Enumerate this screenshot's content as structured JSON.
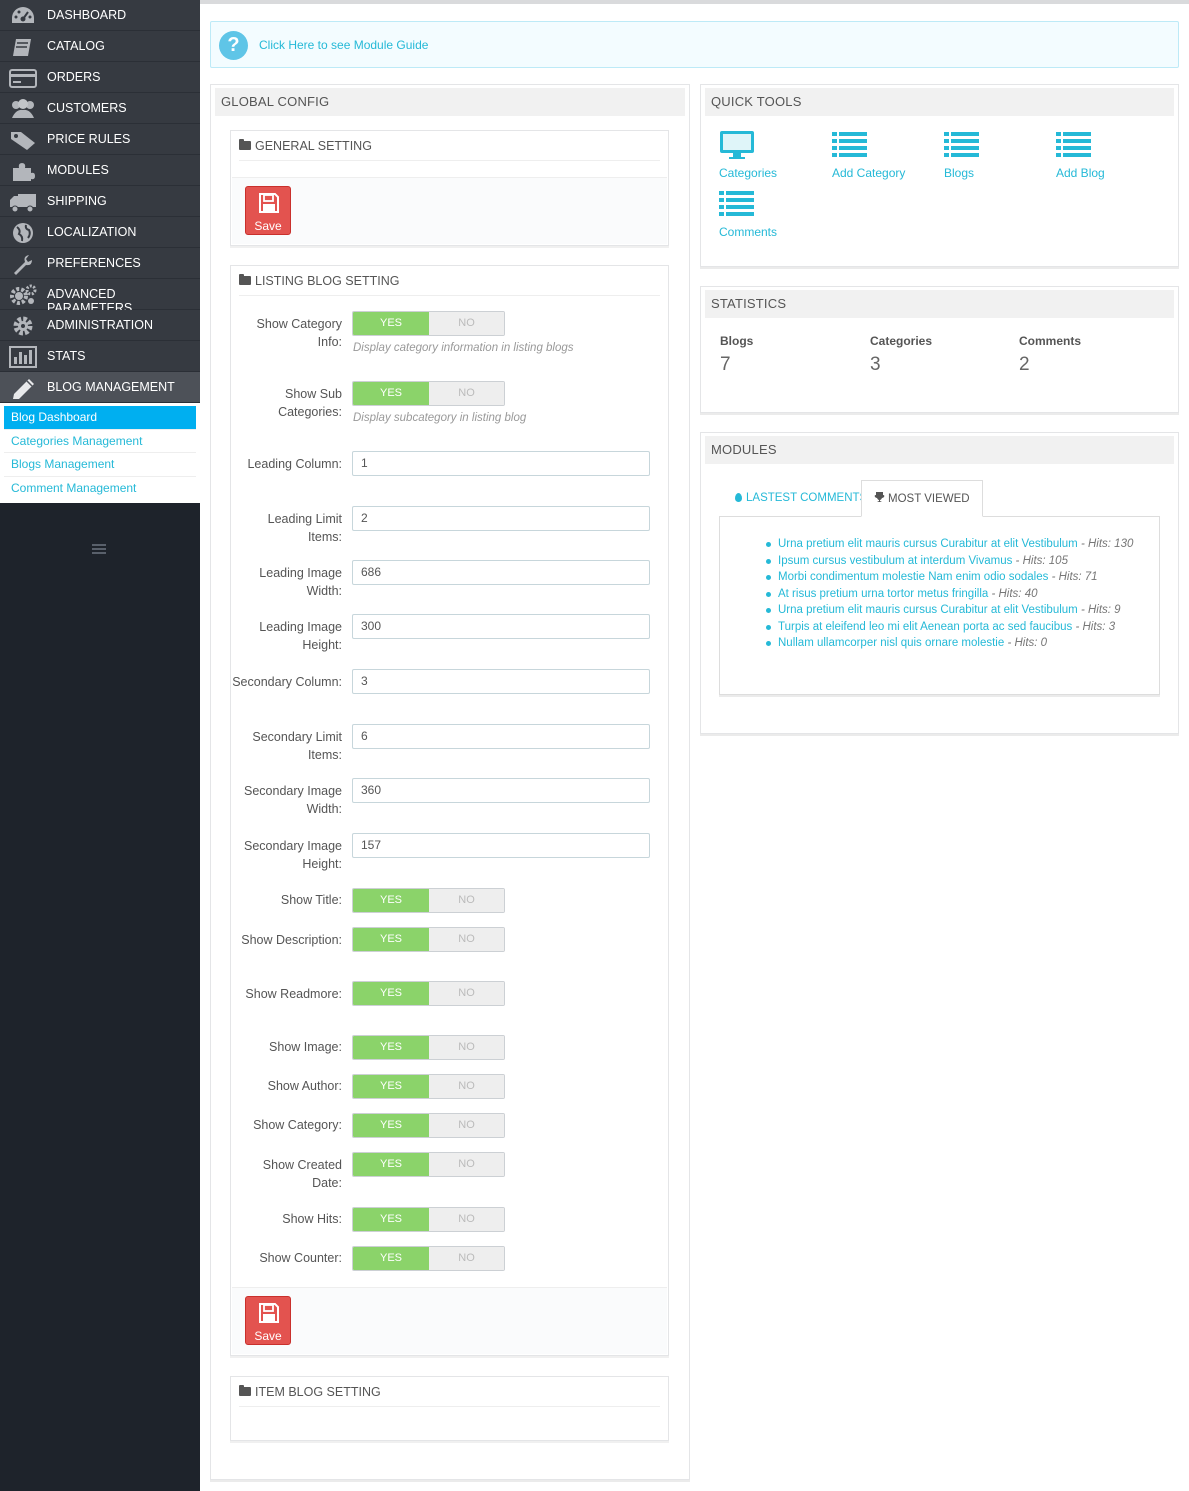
{
  "sidebar": {
    "menu": [
      {
        "label": "DASHBOARD",
        "icon": "dashboard-icon"
      },
      {
        "label": "CATALOG",
        "icon": "book-icon"
      },
      {
        "label": "ORDERS",
        "icon": "credit-card-icon"
      },
      {
        "label": "CUSTOMERS",
        "icon": "users-icon"
      },
      {
        "label": "PRICE RULES",
        "icon": "tags-icon"
      },
      {
        "label": "MODULES",
        "icon": "puzzle-icon"
      },
      {
        "label": "SHIPPING",
        "icon": "truck-icon"
      },
      {
        "label": "LOCALIZATION",
        "icon": "globe-icon"
      },
      {
        "label": "PREFERENCES",
        "icon": "wrench-icon"
      },
      {
        "label": "ADVANCED PARAMETERS",
        "icon": "cogs-icon"
      },
      {
        "label": "ADMINISTRATION",
        "icon": "cog-icon"
      },
      {
        "label": "STATS",
        "icon": "bar-chart-icon"
      },
      {
        "label": "BLOG MANAGEMENT",
        "icon": "pencil-icon"
      }
    ],
    "submenu": [
      "Blog Dashboard",
      "Categories Management",
      "Blogs Management",
      "Comment Management"
    ]
  },
  "guide": {
    "text": "Click Here to see Module Guide"
  },
  "global_config": {
    "title": "GLOBAL CONFIG",
    "general": {
      "title": "GENERAL SETTING",
      "save": "Save"
    },
    "listing": {
      "title": "LISTING BLOG SETTING",
      "save": "Save",
      "toggle_yes": "YES",
      "toggle_no": "NO",
      "show_category_info": {
        "label": "Show Category Info:",
        "help": "Display category information in listing blogs"
      },
      "show_sub_categories": {
        "label": "Show Sub Categories:",
        "help": "Display subcategory in listing blog"
      },
      "leading_column": {
        "label": "Leading Column:",
        "value": "1"
      },
      "leading_limit": {
        "label": "Leading Limit Items:",
        "value": "2"
      },
      "leading_image_width": {
        "label": "Leading Image Width:",
        "value": "686"
      },
      "leading_image_height": {
        "label": "Leading Image Height:",
        "value": "300"
      },
      "secondary_column": {
        "label": "Secondary Column:",
        "value": "3"
      },
      "secondary_limit": {
        "label": "Secondary Limit Items:",
        "value": "6"
      },
      "secondary_image_width": {
        "label": "Secondary Image Width:",
        "value": "360"
      },
      "secondary_image_height": {
        "label": "Secondary Image Height:",
        "value": "157"
      },
      "show_title": {
        "label": "Show Title:"
      },
      "show_description": {
        "label": "Show Description:"
      },
      "show_readmore": {
        "label": "Show Readmore:"
      },
      "show_image": {
        "label": "Show Image:"
      },
      "show_author": {
        "label": "Show Author:"
      },
      "show_category": {
        "label": "Show Category:"
      },
      "show_created_date": {
        "label": "Show Created Date:"
      },
      "show_hits": {
        "label": "Show Hits:"
      },
      "show_counter": {
        "label": "Show Counter:"
      }
    },
    "item": {
      "title": "ITEM BLOG SETTING"
    }
  },
  "quick_tools": {
    "title": "QUICK TOOLS",
    "items": [
      {
        "label": "Categories",
        "icon": "monitor-icon"
      },
      {
        "label": "Add Category",
        "icon": "list-icon"
      },
      {
        "label": "Blogs",
        "icon": "list-icon"
      },
      {
        "label": "Add Blog",
        "icon": "list-icon"
      },
      {
        "label": "Comments",
        "icon": "list-icon"
      }
    ]
  },
  "statistics": {
    "title": "STATISTICS",
    "items": [
      {
        "label": "Blogs",
        "value": "7"
      },
      {
        "label": "Categories",
        "value": "3"
      },
      {
        "label": "Comments",
        "value": "2"
      }
    ]
  },
  "modules": {
    "title": "MODULES",
    "tabs": [
      {
        "label": "LASTEST COMMENTS",
        "icon": "drop-icon",
        "active": false
      },
      {
        "label": "MOST VIEWED",
        "icon": "trophy-icon",
        "active": true
      }
    ],
    "most_viewed": [
      {
        "title": "Urna pretium elit mauris cursus Curabitur at elit Vestibulum",
        "hits": " - Hits: 130"
      },
      {
        "title": "Ipsum cursus vestibulum at interdum Vivamus",
        "hits": " - Hits: 105"
      },
      {
        "title": "Morbi condimentum molestie Nam enim odio sodales",
        "hits": " - Hits: 71"
      },
      {
        "title": "At risus pretium urna tortor metus fringilla",
        "hits": " - Hits: 40"
      },
      {
        "title": "Urna pretium elit mauris cursus Curabitur at elit Vestibulum",
        "hits": " - Hits: 9"
      },
      {
        "title": "Turpis at eleifend leo mi elit Aenean porta ac sed faucibus",
        "hits": " - Hits: 3"
      },
      {
        "title": "Nullam ullamcorper nisl quis ornare molestie",
        "hits": " - Hits: 0"
      }
    ]
  },
  "colors": {
    "sidebar": "#363a41",
    "accent": "#25b9d7",
    "active": "#00aff0",
    "yes": "#8bd36a",
    "save": "#e3534f"
  }
}
